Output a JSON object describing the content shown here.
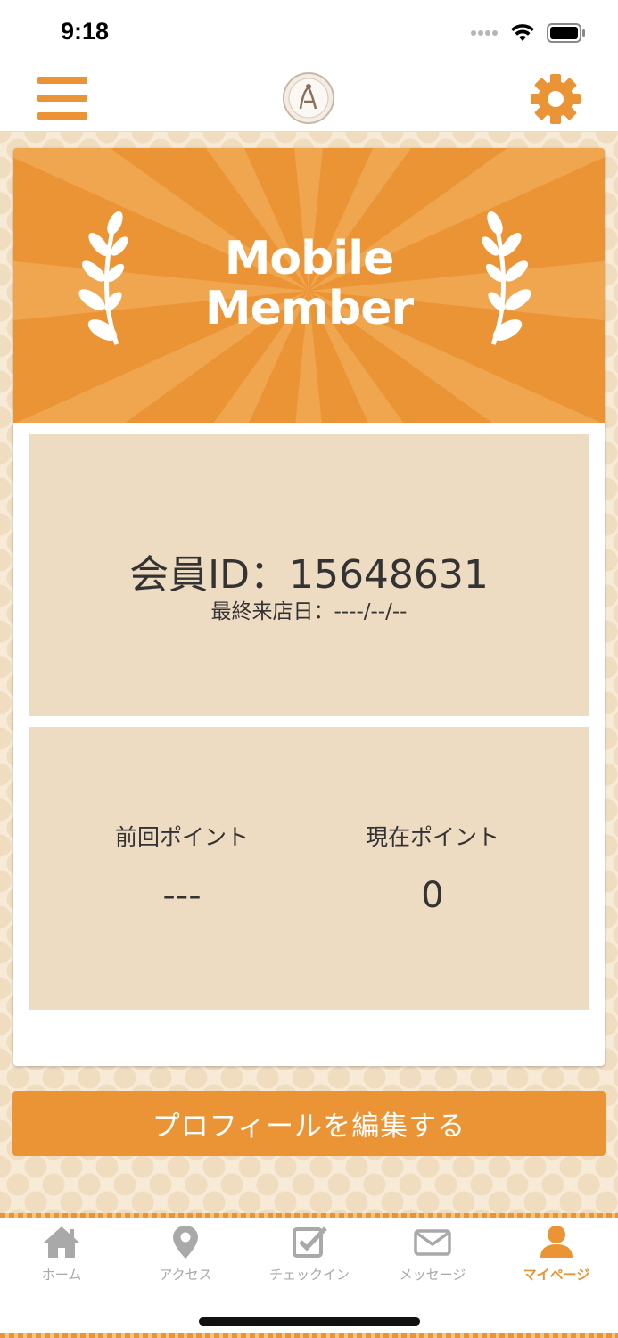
{
  "status_bar": {
    "time": "9:18"
  },
  "header": {
    "menu_icon": "hamburger-menu-icon",
    "logo_icon": "shop-logo",
    "settings_icon": "gear-icon"
  },
  "card": {
    "banner_title_line1": "Mobile",
    "banner_title_line2": "Member",
    "member_id_text": "会員ID：15648631",
    "last_visit_text": "最終来店日：----/--/--",
    "previous_points_label": "前回ポイント",
    "previous_points_value": "---",
    "current_points_label": "現在ポイント",
    "current_points_value": "0"
  },
  "edit_profile_label": "プロフィールを編集する",
  "tabs": [
    {
      "label": "ホーム",
      "icon": "home-icon",
      "active": false
    },
    {
      "label": "アクセス",
      "icon": "map-pin-icon",
      "active": false
    },
    {
      "label": "チェックイン",
      "icon": "checkin-checkbox-icon",
      "active": false
    },
    {
      "label": "メッセージ",
      "icon": "mail-icon",
      "active": false
    },
    {
      "label": "マイページ",
      "icon": "user-icon",
      "active": true
    }
  ],
  "colors": {
    "accent": "#eb9435",
    "panel": "#eddbc2",
    "inactive_tab": "#a9a9a9"
  }
}
